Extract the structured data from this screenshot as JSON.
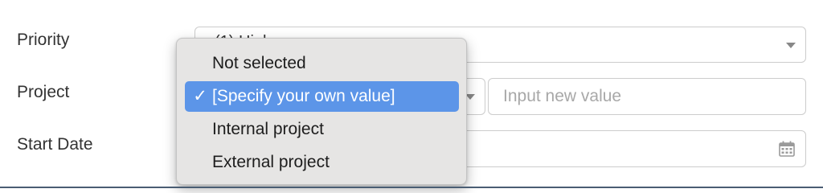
{
  "form": {
    "priority": {
      "label": "Priority",
      "selected_value": "(1) High"
    },
    "project": {
      "label": "Project",
      "input_placeholder": "Input new value"
    },
    "start_date": {
      "label": "Start Date"
    }
  },
  "dropdown": {
    "items": [
      {
        "label": "Not selected",
        "selected": false
      },
      {
        "label": "[Specify your own value]",
        "selected": true
      },
      {
        "label": "Internal project",
        "selected": false
      },
      {
        "label": "External project",
        "selected": false
      }
    ],
    "check_mark": "✓",
    "highlight_color": "#5c95e8"
  },
  "icons": {
    "priority_dropdown": "chevron-down-icon",
    "project_dropdown": "chevron-down-icon",
    "start_date": "calendar-icon"
  }
}
